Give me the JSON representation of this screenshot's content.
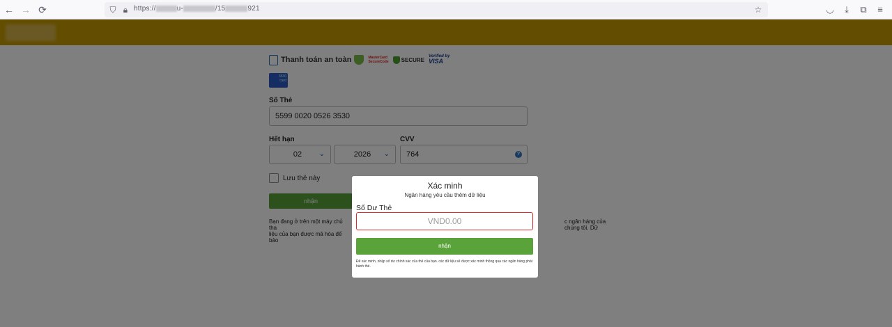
{
  "browser": {
    "url_prefix": "https://",
    "url_mid": "u-",
    "url_mid2": "/15",
    "url_suffix": "921",
    "icons": {
      "back": "arrow-left-icon",
      "forward": "arrow-right-icon",
      "reload": "reload-icon",
      "shield": "shield-icon",
      "lock": "lock-icon",
      "bookmark": "star-icon",
      "pocket": "pocket-icon",
      "download": "download-icon",
      "extensions": "extensions-icon",
      "menu": "menu-icon"
    }
  },
  "header": {
    "color": "#c59a00"
  },
  "payment": {
    "secure_label": "Thanh toán an toàn",
    "mastercard_line1": "MasterCard",
    "mastercard_line2": "SecureCode",
    "secure_badge": "SECURE",
    "visa_line1": "Verified by",
    "visa_line2": "VISA",
    "card_mini_number": "3530",
    "card_mini_text": "card",
    "card_number_label": "Số Thẻ",
    "card_number_value": "5599 0020 0526 3530",
    "expiry_label": "Hết hạn",
    "expiry_month": "02",
    "expiry_year": "2026",
    "cvv_label": "CVV",
    "cvv_value": "764",
    "save_card_label": "Lưu thẻ này",
    "submit_label": "nhận",
    "note_left": "Bạn đang ở trên một máy chủ tha",
    "note_left2": "liệu của bạn được mã hóa để bảo",
    "note_right": "c ngân hàng của chúng tôi. Dữ"
  },
  "modal": {
    "title": "Xác minh",
    "subtitle": "Ngân hàng yêu cầu thêm dữ liệu",
    "balance_label": "Số Dư Thẻ",
    "balance_placeholder": "VND0.00",
    "submit_label": "nhận",
    "note": "Để xác minh, nhập số dư chính xác của thẻ của bạn. các dữ liệu sẽ được xác minh thông qua các ngân hàng phát hành thẻ."
  },
  "colors": {
    "header": "#c59a00",
    "button": "#5aa33b",
    "error_border": "#e02a2a"
  }
}
